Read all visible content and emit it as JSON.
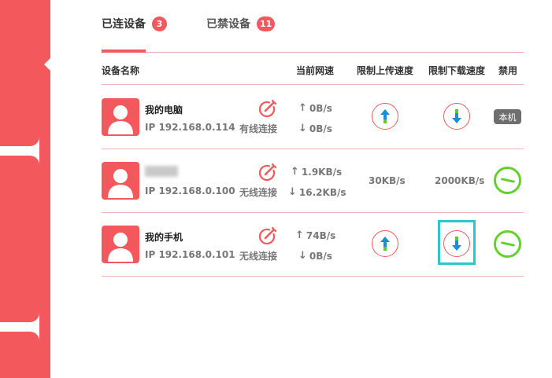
{
  "tabs": {
    "connected": {
      "label": "已连设备",
      "count": "3"
    },
    "blocked": {
      "label": "已禁设备",
      "count": "11"
    }
  },
  "columns": {
    "name": "设备名称",
    "speed": "当前网速",
    "upload_limit": "限制上传速度",
    "download_limit": "限制下载速度",
    "block": "禁用"
  },
  "devices": [
    {
      "name": "我的电脑",
      "ip": "IP 192.168.0.114",
      "connection": "有线连接",
      "up_speed": "0B/s",
      "down_speed": "0B/s",
      "upload_limit": "",
      "download_limit": "",
      "block_label": "本机"
    },
    {
      "name": "",
      "ip": "IP 192.168.0.100",
      "connection": "无线连接",
      "up_speed": "1.9KB/s",
      "down_speed": "16.2KB/s",
      "upload_limit": "30KB/s",
      "download_limit": "2000KB/s",
      "block_label": ""
    },
    {
      "name": "我的手机",
      "ip": "IP 192.168.0.101",
      "connection": "无线连接",
      "up_speed": "74B/s",
      "down_speed": "0B/s",
      "upload_limit": "",
      "download_limit": "",
      "block_label": ""
    }
  ],
  "colors": {
    "accent": "#f2585c",
    "upload_arrow": "#1a8fd6",
    "download_arrow": "#1a8fd6",
    "arrow_tail": "#5cc832",
    "ban": "#64d12b",
    "focus": "#2ec5cc"
  },
  "icons": {
    "avatar": "user-avatar-icon",
    "edit": "edit-pen-icon",
    "upload": "arrow-up-icon",
    "download": "arrow-down-icon",
    "ban": "ban-icon"
  }
}
